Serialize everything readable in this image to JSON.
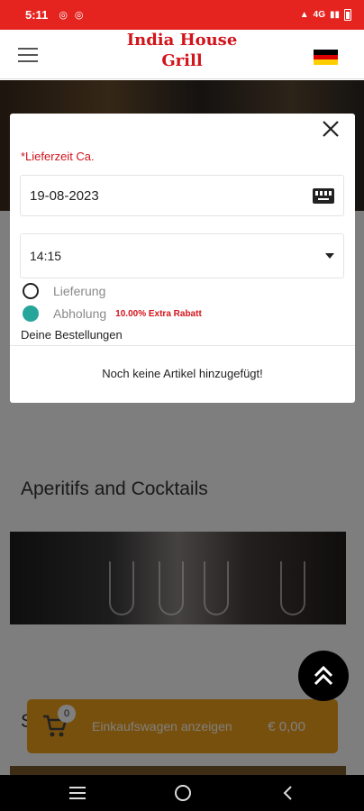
{
  "status_bar": {
    "time": "5:11",
    "left_icons": [
      "sim-icon",
      "sim-icon"
    ],
    "network": "4G",
    "bg_color": "#e52420"
  },
  "header": {
    "brand_line1": "India House",
    "brand_line2": "Grill",
    "brand_color": "#d2141b",
    "language_flag": "german-flag-icon"
  },
  "modal": {
    "delivery_time_label": "*Lieferzeit Ca.",
    "date_value": "19-08-2023",
    "time_value": "14:15",
    "options": [
      {
        "label": "Lieferung",
        "selected": false,
        "note": ""
      },
      {
        "label": "Abholung",
        "selected": true,
        "note": "10.00% Extra Rabatt"
      }
    ],
    "orders_title": "Deine Bestellungen",
    "empty_message": "Noch keine Artikel hinzugefügt!",
    "accent_color": "#26a69a"
  },
  "page": {
    "category_title": "Aperitifs and Cocktails",
    "next_category_initial": "S"
  },
  "cart": {
    "count": "0",
    "label": "Einkaufswagen anzeigen",
    "total": "€ 0,00",
    "color": "#f0a01a"
  },
  "nav_bar": {
    "icons": [
      "recent-apps-icon",
      "home-icon",
      "back-icon"
    ]
  }
}
